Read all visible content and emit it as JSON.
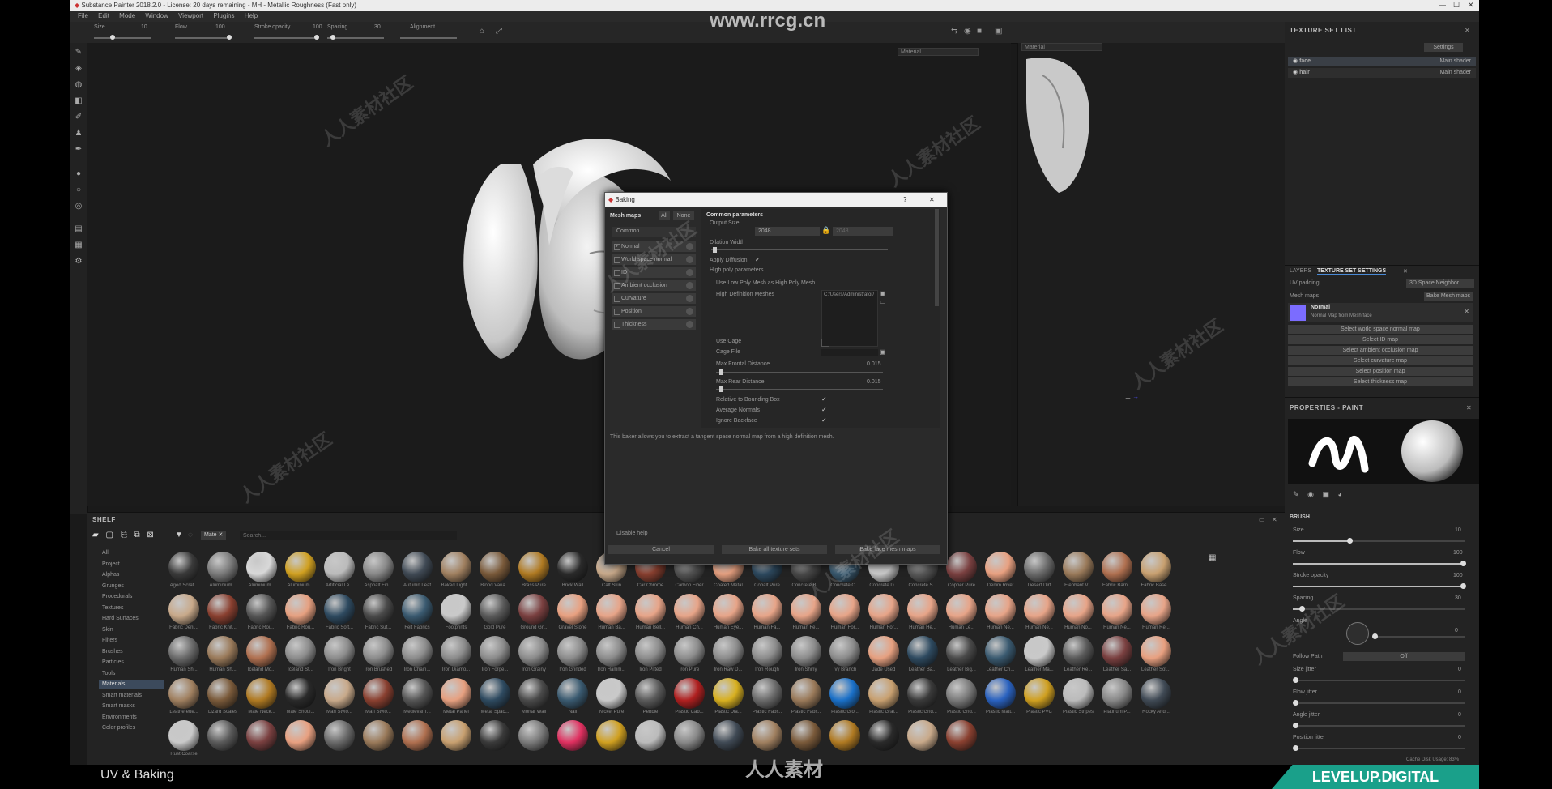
{
  "app": {
    "title": "Substance Painter 2018.2.0 - License: 20 days remaining - MH - Metallic Roughness (Fast only)",
    "menu": [
      "File",
      "Edit",
      "Mode",
      "Window",
      "Viewport",
      "Plugins",
      "Help"
    ]
  },
  "toolbar": {
    "size_label": "Size",
    "size_value": "10",
    "flow_label": "Flow",
    "flow_value": "100",
    "stroke_label": "Stroke opacity",
    "stroke_value": "100",
    "spacing_label": "Spacing",
    "spacing_value": "30",
    "alignment_label": "Alignment"
  },
  "watermark_top": "www.rrcg.cn",
  "viewport": {
    "material_select": "Material",
    "material_select_2d": "Material"
  },
  "texture_set_list": {
    "title": "TEXTURE SET LIST",
    "settings_label": "Settings",
    "items": [
      {
        "name": "face",
        "shader": "Main shader"
      },
      {
        "name": "hair",
        "shader": "Main shader"
      }
    ]
  },
  "tss": {
    "tab_layers": "LAYERS",
    "tab_settings": "TEXTURE SET SETTINGS",
    "uv_padding_label": "UV padding",
    "uv_padding_value": "3D Space Neighbor",
    "mesh_maps_label": "Mesh maps",
    "bake_button": "Bake Mesh maps",
    "normal_title": "Normal",
    "normal_sub": "Normal Map from Mesh face",
    "slots": [
      "Select world space normal map",
      "Select ID map",
      "Select ambient occlusion map",
      "Select curvature map",
      "Select position map",
      "Select thickness map"
    ]
  },
  "properties": {
    "title": "PROPERTIES - PAINT",
    "brush_section": "BRUSH",
    "size_label": "Size",
    "size_value": "10",
    "flow_label": "Flow",
    "flow_value": "100",
    "stroke_label": "Stroke opacity",
    "stroke_value": "100",
    "spacing_label": "Spacing",
    "spacing_value": "30",
    "angle_label": "Angle",
    "angle_value": "0",
    "follow_path_label": "Follow Path",
    "follow_path_value": "Off",
    "size_jitter_label": "Size jitter",
    "size_jitter_value": "0",
    "flow_jitter_label": "Flow jitter",
    "flow_jitter_value": "0",
    "angle_jitter_label": "Angle jitter",
    "angle_jitter_value": "0",
    "position_jitter_label": "Position jitter",
    "position_jitter_value": "0",
    "cache_label": "Cache Disk Usage: 83%"
  },
  "dialog": {
    "title": "Baking",
    "help": "?",
    "close": "✕",
    "mesh_maps_label": "Mesh maps",
    "all_label": "All",
    "none_label": "None",
    "common_label": "Common",
    "maps": [
      {
        "name": "Normal",
        "checked": true
      },
      {
        "name": "World space normal",
        "checked": false
      },
      {
        "name": "ID",
        "checked": false
      },
      {
        "name": "Ambient occlusion",
        "checked": false
      },
      {
        "name": "Curvature",
        "checked": false
      },
      {
        "name": "Position",
        "checked": false
      },
      {
        "name": "Thickness",
        "checked": false
      }
    ],
    "common_params": "Common parameters",
    "output_size_label": "Output Size",
    "output_size_value": "2048",
    "output_size_value_2": "2048",
    "dilation_label": "Dilation Width",
    "apply_diffusion_label": "Apply Diffusion",
    "high_poly_label": "High poly parameters",
    "use_low_poly_label": "Use Low Poly Mesh as High Poly Mesh",
    "hd_meshes_label": "High Definition Meshes",
    "hd_meshes_value": "C:/Users/Administrator/",
    "use_cage_label": "Use Cage",
    "cage_file_label": "Cage File",
    "max_frontal_label": "Max Frontal Distance",
    "max_frontal_value": "0.015",
    "max_rear_label": "Max Rear Distance",
    "max_rear_value": "0.015",
    "relative_label": "Relative to Bounding Box",
    "average_normals_label": "Average Normals",
    "ignore_backface_label": "Ignore Backface",
    "description": "This baker allows you to extract a tangent space normal map from a high definition mesh.",
    "disable_help": "Disable help",
    "cancel": "Cancel",
    "bake_all": "Bake all texture sets",
    "bake_selected": "Bake face mesh maps"
  },
  "shelf": {
    "title": "SHELF",
    "filter_tag": "Mate",
    "search_placeholder": "Search...",
    "categories": [
      "All",
      "Project",
      "Alphas",
      "Grunges",
      "Procedurals",
      "Textures",
      "Hard Surfaces",
      "Skin",
      "Filters",
      "Brushes",
      "Particles",
      "Tools",
      "Materials",
      "Smart materials",
      "Smart masks",
      "Environments",
      "Color profiles"
    ],
    "selected_category": "Materials",
    "materials": [
      [
        "Aged Scrat...",
        "Aluminium...",
        "Aluminium...",
        "Aluminium...",
        "Artificial Le...",
        "Asphalt Fin...",
        "Autumn Leaf",
        "Baked Light...",
        "Blood Varia...",
        "Brass Pure",
        "Brick Wall",
        "Calf Skin",
        "Car Chrome",
        "Carbon Fiber",
        "Coated Metal",
        "Cobalt Pure",
        "Concrete B...",
        "Concrete C...",
        "Concrete D...",
        "Concrete S...",
        "Copper Pure",
        "Denim Rivet",
        "Desert Dirt",
        "Elephant V...",
        "Fabric Barn...",
        "Fabric Base..."
      ],
      [
        "Fabric Deni...",
        "Fabric Knit...",
        "Fabric Rou...",
        "Fabric Rou...",
        "Fabric Soft...",
        "Fabric Suf...",
        "Felt Fabrics",
        "Footprints",
        "Gold Pure",
        "Ground Gr...",
        "Gravel Stone",
        "Human Ba...",
        "Human Bell...",
        "Human Ch...",
        "Human Eye...",
        "Human Fa...",
        "Human Fe...",
        "Human For...",
        "Human For...",
        "Human He...",
        "Human Le...",
        "Human Ne...",
        "Human Ne...",
        "Human No...",
        "Human Ne...",
        "Human Re..."
      ],
      [
        "Human Sh...",
        "Human Sh...",
        "Iceland Mo...",
        "Iceland St...",
        "Iron Bright",
        "Iron Brushed",
        "Iron Chain...",
        "Iron Diamo...",
        "Iron Forge...",
        "Iron Grainy",
        "Iron Grinded",
        "Iron Hamm...",
        "Iron Pitted",
        "Iron Pure",
        "Iron Raw D...",
        "Iron Rough",
        "Iron Shiny",
        "Ivy Branch",
        "Jade Used",
        "Leather Ba...",
        "Leather Big...",
        "Leather Ch...",
        "Leather Ma...",
        "Leather Re...",
        "Leather Sa...",
        "Leather Sof..."
      ],
      [
        "Leatherette...",
        "Lizard Scales",
        "Male Neck...",
        "Male Shoul...",
        "Marl Stylo...",
        "Marl Stylo...",
        "Medieval T...",
        "Metal Panel",
        "Metal Spac...",
        "Mortar Wall",
        "Nail",
        "Nickel Pure",
        "Pebble",
        "Plastic Cab...",
        "Plastic Dia...",
        "Plastic Fabr...",
        "Plastic Fabr...",
        "Plastic Glo...",
        "Plastic Grai...",
        "Plastic Grid...",
        "Plastic Grid...",
        "Plastic Matt...",
        "Plastic PVC",
        "Plastic Stripes",
        "Platinum P...",
        "Rocky Arid..."
      ],
      [
        "Rust Coarse",
        "",
        "",
        "",
        "",
        "",
        "",
        "",
        "",
        "",
        "",
        "",
        "",
        "",
        "",
        "",
        "",
        "",
        "",
        "",
        "",
        "",
        "",
        "",
        "",
        ""
      ]
    ]
  },
  "bottom": {
    "label": "UV & Baking",
    "brand": "LEVELUP.DIGITAL",
    "watermark": "人人素材"
  }
}
